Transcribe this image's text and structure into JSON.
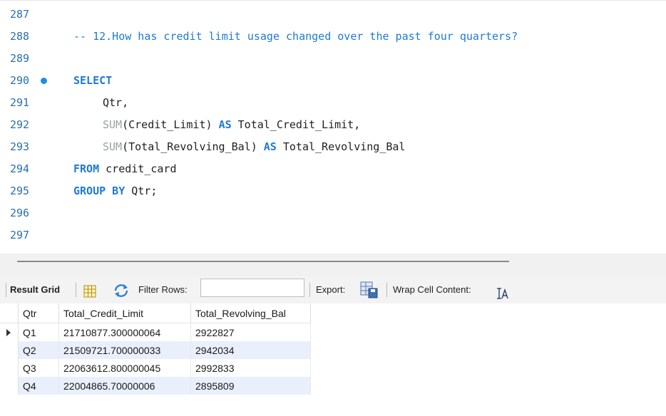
{
  "editor": {
    "lines": [
      {
        "num": "287"
      },
      {
        "num": "288",
        "comment": "-- 12.How has credit limit usage changed over the past four quarters?"
      },
      {
        "num": "289"
      },
      {
        "num": "290",
        "kw": "SELECT"
      },
      {
        "num": "291",
        "text": "Qtr,"
      },
      {
        "num": "292",
        "fn": "SUM",
        "arg": "(Credit_Limit) ",
        "kw": "AS",
        "rest": " Total_Credit_Limit,"
      },
      {
        "num": "293",
        "fn": "SUM",
        "arg": "(Total_Revolving_Bal) ",
        "kw": "AS",
        "rest": " Total_Revolving_Bal"
      },
      {
        "num": "294",
        "kw": "FROM",
        "rest": " credit_card"
      },
      {
        "num": "295",
        "kw": "GROUP BY",
        "rest": " Qtr;"
      },
      {
        "num": "296"
      },
      {
        "num": "297"
      }
    ]
  },
  "toolbar": {
    "result_grid": "Result Grid",
    "filter_rows": "Filter Rows:",
    "filter_value": "",
    "export": "Export:",
    "wrap_cell": "Wrap Cell Content:"
  },
  "grid": {
    "columns": [
      "Qtr",
      "Total_Credit_Limit",
      "Total_Revolving_Bal"
    ],
    "rows": [
      [
        "Q1",
        "21710877.300000064",
        "2922827"
      ],
      [
        "Q2",
        "21509721.700000033",
        "2942034"
      ],
      [
        "Q3",
        "22063612.800000045",
        "2992833"
      ],
      [
        "Q4",
        "22004865.70000006",
        "2895809"
      ]
    ]
  },
  "colors": {
    "keyword": "#1e7ad6",
    "line_number": "#2a6fb0",
    "alt_row": "#e9f0fb"
  }
}
